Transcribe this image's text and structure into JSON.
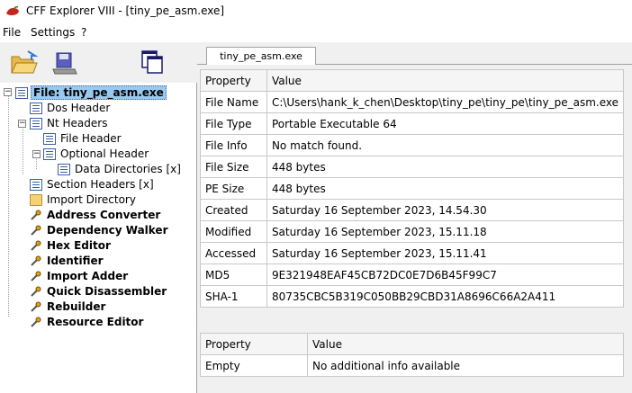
{
  "window": {
    "title": "CFF Explorer VIII - [tiny_pe_asm.exe]"
  },
  "menu": {
    "items": [
      "File",
      "Settings",
      "?"
    ]
  },
  "toolbar": {
    "buttons": [
      "open-icon",
      "save-icon",
      "windows-icon"
    ]
  },
  "tree": {
    "root": "File: tiny_pe_asm.exe",
    "dos_header": "Dos Header",
    "nt_headers": "Nt Headers",
    "file_header": "File Header",
    "optional_header": "Optional Header",
    "data_directories": "Data Directories [x]",
    "section_headers": "Section Headers [x]",
    "import_directory": "Import Directory",
    "tools": [
      "Address Converter",
      "Dependency Walker",
      "Hex Editor",
      "Identifier",
      "Import Adder",
      "Quick Disassembler",
      "Rebuilder",
      "Resource Editor"
    ]
  },
  "tab": {
    "label": "tiny_pe_asm.exe"
  },
  "file_info": {
    "headers": [
      "Property",
      "Value"
    ],
    "rows": [
      [
        "File Name",
        "C:\\Users\\hank_k_chen\\Desktop\\tiny_pe\\tiny_pe\\tiny_pe_asm.exe"
      ],
      [
        "File Type",
        "Portable Executable 64"
      ],
      [
        "File Info",
        "No match found."
      ],
      [
        "File Size",
        "448 bytes"
      ],
      [
        "PE Size",
        "448 bytes"
      ],
      [
        "Created",
        "Saturday 16 September 2023, 14.54.30"
      ],
      [
        "Modified",
        "Saturday 16 September 2023, 15.11.18"
      ],
      [
        "Accessed",
        "Saturday 16 September 2023, 15.11.41"
      ],
      [
        "MD5",
        "9E321948EAF45CB72DC0E7D6B45F99C7"
      ],
      [
        "SHA-1",
        "80735CBC5B319C050BB29CBD31A8696C66A2A411"
      ]
    ]
  },
  "additional_info": {
    "headers": [
      "Property",
      "Value"
    ],
    "rows": [
      [
        "Empty",
        "No additional info available"
      ]
    ]
  }
}
